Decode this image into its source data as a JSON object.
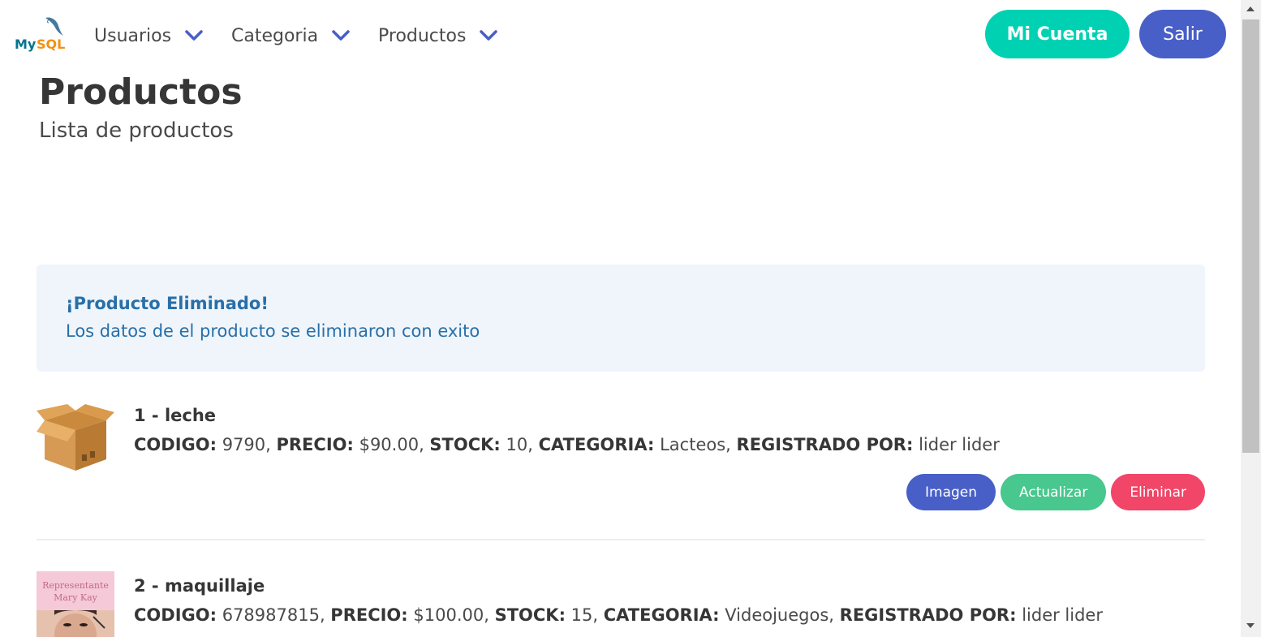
{
  "logo": {
    "text": "MySQL"
  },
  "nav": {
    "items": [
      {
        "label": "Usuarios"
      },
      {
        "label": "Categoria"
      },
      {
        "label": "Productos"
      }
    ],
    "account_label": "Mi Cuenta",
    "exit_label": "Salir"
  },
  "header": {
    "title": "Productos",
    "subtitle": "Lista de productos"
  },
  "notification": {
    "title": "¡Producto Eliminado!",
    "message": "Los datos de el producto se eliminaron con exito"
  },
  "labels": {
    "codigo": "CODIGO:",
    "precio": "PRECIO:",
    "stock": "STOCK:",
    "categoria": "CATEGORIA:",
    "registrado": "REGISTRADO POR:",
    "btn_imagen": "Imagen",
    "btn_actualizar": "Actualizar",
    "btn_eliminar": "Eliminar"
  },
  "products": [
    {
      "title": "1 - leche",
      "codigo": "9790",
      "precio": "$90.00",
      "stock": "10",
      "categoria": "Lacteos",
      "registrado": "lider lider",
      "image_icon": "cardboard-box-icon"
    },
    {
      "title": "2 - maquillaje",
      "codigo": "678987815",
      "precio": "$100.00",
      "stock": "15",
      "categoria": "Videojuegos",
      "registrado": "lider lider",
      "image_text": "Representante Mary Kay"
    }
  ],
  "colors": {
    "primary": "#485fc7",
    "accent": "#00d1b2",
    "success": "#48c78e",
    "danger": "#f14668",
    "info_text": "#296fa8",
    "info_bg": "#eff5fb"
  }
}
